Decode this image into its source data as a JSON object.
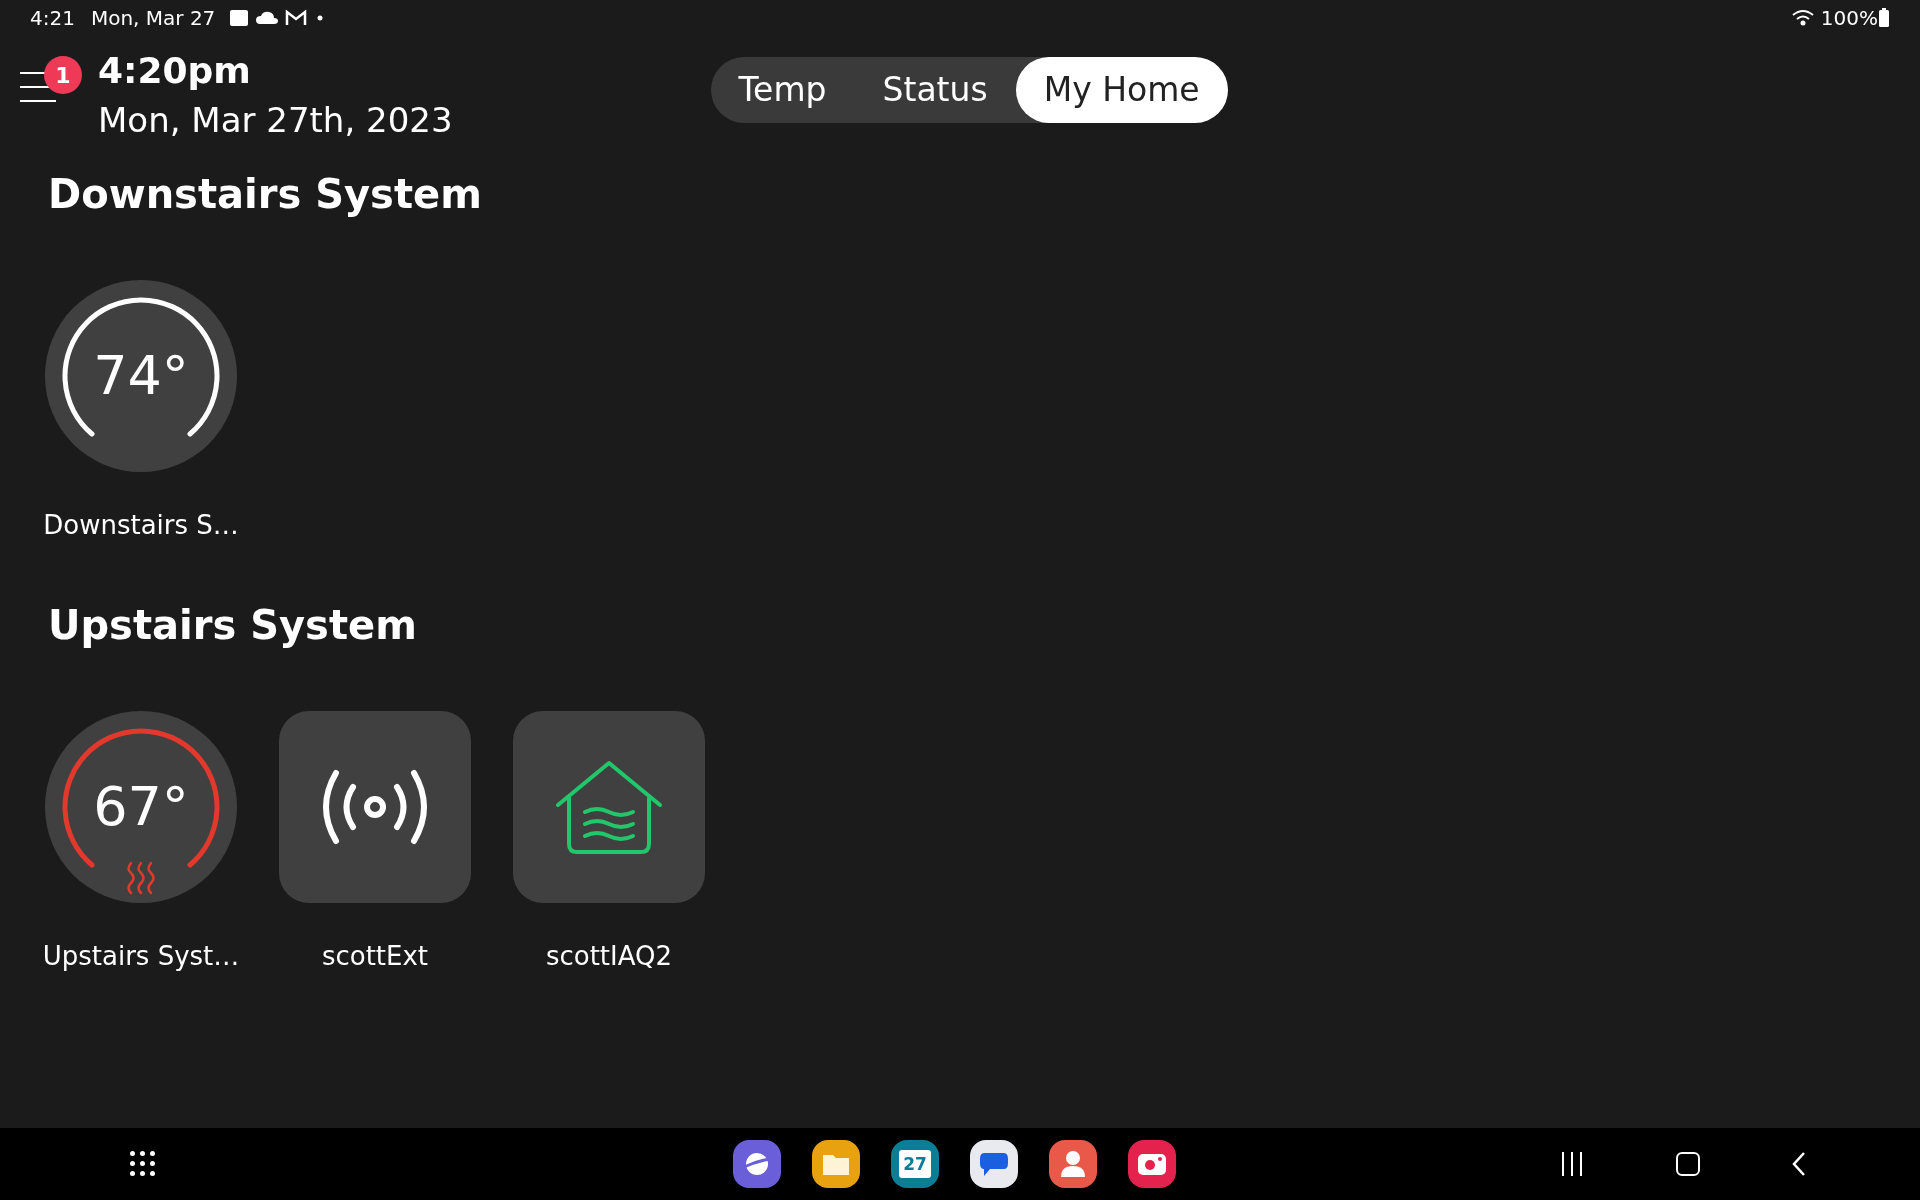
{
  "status_bar": {
    "time": "4:21",
    "date": "Mon, Mar 27",
    "battery": "100%"
  },
  "header": {
    "notification_count": "1",
    "time": "4:20pm",
    "date": "Mon, Mar 27th, 2023"
  },
  "tabs": [
    {
      "label": "Temp",
      "selected": false
    },
    {
      "label": "Status",
      "selected": false
    },
    {
      "label": "My Home",
      "selected": true
    }
  ],
  "sections": [
    {
      "title": "Downstairs System",
      "devices": [
        {
          "kind": "thermostat",
          "name": "Downstairs S…",
          "temperature": "74°",
          "heating": false
        }
      ]
    },
    {
      "title": "Upstairs System",
      "devices": [
        {
          "kind": "thermostat",
          "name": "Upstairs Syst…",
          "temperature": "67°",
          "heating": true
        },
        {
          "kind": "sensor",
          "name": "scottExt"
        },
        {
          "kind": "air_quality",
          "name": "scottIAQ2"
        }
      ]
    }
  ],
  "taskbar": {
    "apps": [
      {
        "kind": "browser"
      },
      {
        "kind": "files"
      },
      {
        "kind": "calendar",
        "label": "27"
      },
      {
        "kind": "messages"
      },
      {
        "kind": "contacts"
      },
      {
        "kind": "camera"
      }
    ]
  }
}
